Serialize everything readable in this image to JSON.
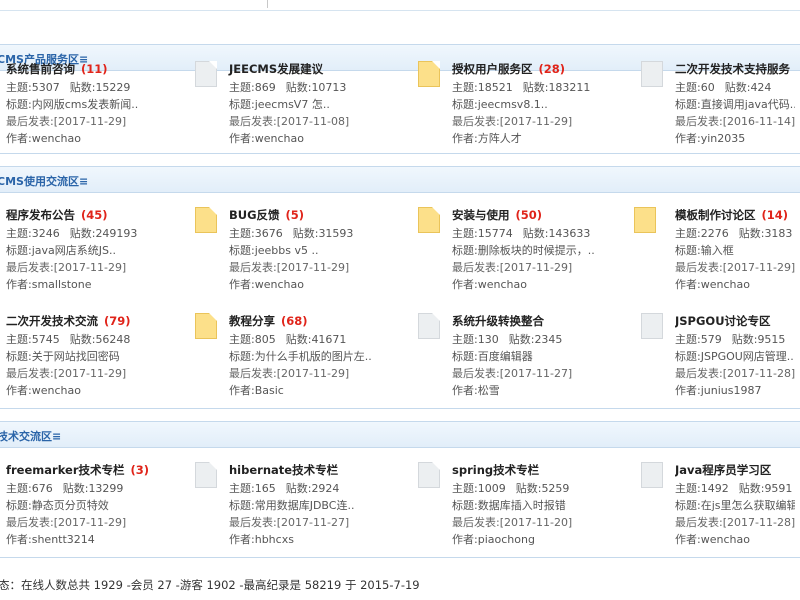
{
  "sections": [
    {
      "title": "CMS产品服务区≡",
      "forums": [
        {
          "name": "系统售前咨询",
          "count": "(11)",
          "topics_label": "主题:",
          "topics": "5307",
          "posts_label": "贴数:",
          "posts": "15229",
          "topic_label": "标题:",
          "topic": "内网版cms发表新闻..",
          "last_label": "最后发表:",
          "last": "[2017-11-29]",
          "author_label": "作者:",
          "author": "wenchao",
          "icon": "doc-gray"
        },
        {
          "name": "JEECMS发展建议",
          "count": "",
          "topics_label": "主题:",
          "topics": "869",
          "posts_label": "贴数:",
          "posts": "10713",
          "topic_label": "标题:",
          "topic": "jeecmsV7 怎..",
          "last_label": "最后发表:",
          "last": "[2017-11-08]",
          "author_label": "作者:",
          "author": "wenchao",
          "icon": "doc-gray"
        },
        {
          "name": "授权用户服务区",
          "count": "(28)",
          "topics_label": "主题:",
          "topics": "18521",
          "posts_label": "贴数:",
          "posts": "183211",
          "topic_label": "标题:",
          "topic": "jeecmsv8.1..",
          "last_label": "最后发表:",
          "last": "[2017-11-29]",
          "author_label": "作者:",
          "author": "方阵人才",
          "icon": "doc-yellow"
        },
        {
          "name": "二次开发技术支持服务",
          "count": "",
          "topics_label": "主题:",
          "topics": "60",
          "posts_label": "贴数:",
          "posts": "424",
          "topic_label": "标题:",
          "topic": "直接调用java代码..",
          "last_label": "最后发表:",
          "last": "[2016-11-14]",
          "author_label": "作者:",
          "author": "yin2035",
          "icon": "doc-gray"
        }
      ]
    },
    {
      "title": "CMS使用交流区≡",
      "forums": [
        {
          "name": "程序发布公告",
          "count": "(45)",
          "topics_label": "主题:",
          "topics": "3246",
          "posts_label": "贴数:",
          "posts": "249193",
          "topic_label": "标题:",
          "topic": "java网店系统JS..",
          "last_label": "最后发表:",
          "last": "[2017-11-29]",
          "author_label": "作者:",
          "author": "smallstone",
          "icon": "doc-yellow"
        },
        {
          "name": "BUG反馈",
          "count": "(5)",
          "topics_label": "主题:",
          "topics": "3676",
          "posts_label": "贴数:",
          "posts": "31593",
          "topic_label": "标题:",
          "topic": "jeebbs v5 ..",
          "last_label": "最后发表:",
          "last": "[2017-11-29]",
          "author_label": "作者:",
          "author": "wenchao",
          "icon": "doc-yellow"
        },
        {
          "name": "安装与使用",
          "count": "(50)",
          "topics_label": "主题:",
          "topics": "15774",
          "posts_label": "贴数:",
          "posts": "143633",
          "topic_label": "标题:",
          "topic": "删除板块的时候提示，..",
          "last_label": "最后发表:",
          "last": "[2017-11-29]",
          "author_label": "作者:",
          "author": "wenchao",
          "icon": "doc-yellow"
        },
        {
          "name": "模板制作讨论区",
          "count": "(14)",
          "topics_label": "主题:",
          "topics": "2276",
          "posts_label": "贴数:",
          "posts": "3183",
          "topic_label": "标题:",
          "topic": "输入框",
          "last_label": "最后发表:",
          "last": "[2017-11-29]",
          "author_label": "作者:",
          "author": "wenchao",
          "icon": "doc-yellow"
        },
        {
          "name": "二次开发技术交流",
          "count": "(79)",
          "topics_label": "主题:",
          "topics": "5745",
          "posts_label": "贴数:",
          "posts": "56248",
          "topic_label": "标题:",
          "topic": "关于网站找回密码",
          "last_label": "最后发表:",
          "last": "[2017-11-29]",
          "author_label": "作者:",
          "author": "wenchao",
          "icon": "doc-yellow"
        },
        {
          "name": "教程分享",
          "count": "(68)",
          "topics_label": "主题:",
          "topics": "805",
          "posts_label": "贴数:",
          "posts": "41671",
          "topic_label": "标题:",
          "topic": "为什么手机版的图片左..",
          "last_label": "最后发表:",
          "last": "[2017-11-29]",
          "author_label": "作者:",
          "author": "Basic",
          "icon": "doc-yellow"
        },
        {
          "name": "系统升级转换整合",
          "count": "",
          "topics_label": "主题:",
          "topics": "130",
          "posts_label": "贴数:",
          "posts": "2345",
          "topic_label": "标题:",
          "topic": "百度编辑器",
          "last_label": "最后发表:",
          "last": "[2017-11-27]",
          "author_label": "作者:",
          "author": "松雪",
          "icon": "doc-gray"
        },
        {
          "name": "JSPGOU讨论专区",
          "count": "",
          "topics_label": "主题:",
          "topics": "579",
          "posts_label": "贴数:",
          "posts": "9515",
          "topic_label": "标题:",
          "topic": "JSPGOU网店管理..",
          "last_label": "最后发表:",
          "last": "[2017-11-28]",
          "author_label": "作者:",
          "author": "junius1987",
          "icon": "doc-gray"
        }
      ]
    },
    {
      "title": "技术交流区≡",
      "forums": [
        {
          "name": "freemarker技术专栏",
          "count": "(3)",
          "topics_label": "主题:",
          "topics": "676",
          "posts_label": "贴数:",
          "posts": "13299",
          "topic_label": "标题:",
          "topic": "静态页分页特效",
          "last_label": "最后发表:",
          "last": "[2017-11-29]",
          "author_label": "作者:",
          "author": "shentt3214",
          "icon": "doc-gray"
        },
        {
          "name": "hibernate技术专栏",
          "count": "",
          "topics_label": "主题:",
          "topics": "165",
          "posts_label": "贴数:",
          "posts": "2924",
          "topic_label": "标题:",
          "topic": "常用数据库JDBC连..",
          "last_label": "最后发表:",
          "last": "[2017-11-27]",
          "author_label": "作者:",
          "author": "hbhcxs",
          "icon": "doc-gray"
        },
        {
          "name": "spring技术专栏",
          "count": "",
          "topics_label": "主题:",
          "topics": "1009",
          "posts_label": "贴数:",
          "posts": "5259",
          "topic_label": "标题:",
          "topic": "数据库插入时报错",
          "last_label": "最后发表:",
          "last": "[2017-11-20]",
          "author_label": "作者:",
          "author": "piaochong",
          "icon": "doc-gray"
        },
        {
          "name": "Java程序员学习区",
          "count": "",
          "topics_label": "主题:",
          "topics": "1492",
          "posts_label": "贴数:",
          "posts": "9591",
          "topic_label": "标题:",
          "topic": "在js里怎么获取编辑",
          "last_label": "最后发表:",
          "last": "[2017-11-28]",
          "author_label": "作者:",
          "author": "wenchao",
          "icon": "doc-gray"
        }
      ]
    }
  ],
  "footer": {
    "status": "态：在线人数总共 1929 -会员 27 -游客 1902  -最高纪录是  58219 于 2015-7-19"
  }
}
